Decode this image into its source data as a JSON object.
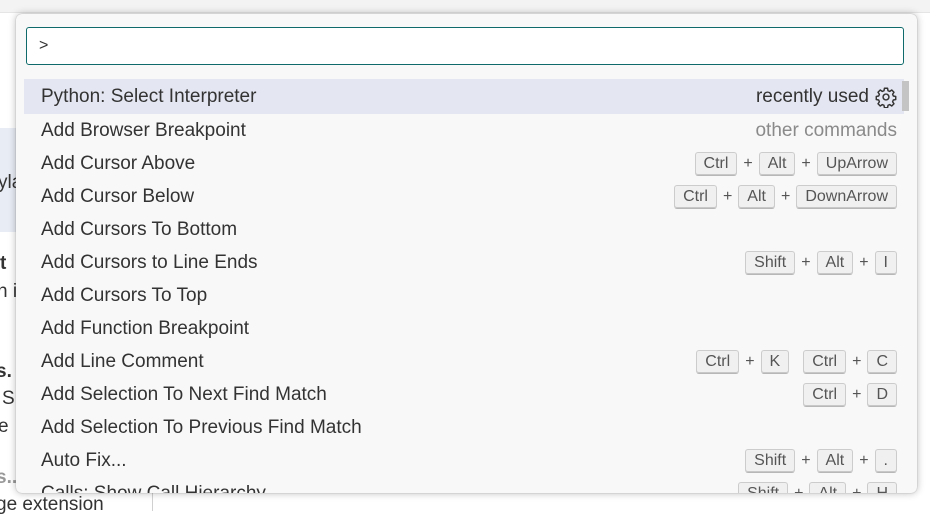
{
  "background": {
    "fragments": [
      "yla",
      "t",
      "n i",
      "s.",
      "S",
      "e",
      "s...",
      "ge extension"
    ]
  },
  "quick_pick": {
    "input_value": ">",
    "items": [
      {
        "label": "Python: Select Interpreter",
        "description": "recently used",
        "has_gear": true,
        "selected": true,
        "keys": []
      },
      {
        "label": "Add Browser Breakpoint",
        "description": "other commands",
        "keys": []
      },
      {
        "label": "Add Cursor Above",
        "keys": [
          [
            "Ctrl",
            "Alt",
            "UpArrow"
          ]
        ]
      },
      {
        "label": "Add Cursor Below",
        "keys": [
          [
            "Ctrl",
            "Alt",
            "DownArrow"
          ]
        ]
      },
      {
        "label": "Add Cursors To Bottom",
        "keys": []
      },
      {
        "label": "Add Cursors to Line Ends",
        "keys": [
          [
            "Shift",
            "Alt",
            "I"
          ]
        ]
      },
      {
        "label": "Add Cursors To Top",
        "keys": []
      },
      {
        "label": "Add Function Breakpoint",
        "keys": []
      },
      {
        "label": "Add Line Comment",
        "keys": [
          [
            "Ctrl",
            "K"
          ],
          [
            "Ctrl",
            "C"
          ]
        ]
      },
      {
        "label": "Add Selection To Next Find Match",
        "keys": [
          [
            "Ctrl",
            "D"
          ]
        ]
      },
      {
        "label": "Add Selection To Previous Find Match",
        "keys": []
      },
      {
        "label": "Auto Fix...",
        "keys": [
          [
            "Shift",
            "Alt",
            "."
          ]
        ]
      },
      {
        "label": "Calls: Show Call Hierarchy",
        "keys": [
          [
            "Shift",
            "Alt",
            "H"
          ]
        ]
      }
    ]
  }
}
